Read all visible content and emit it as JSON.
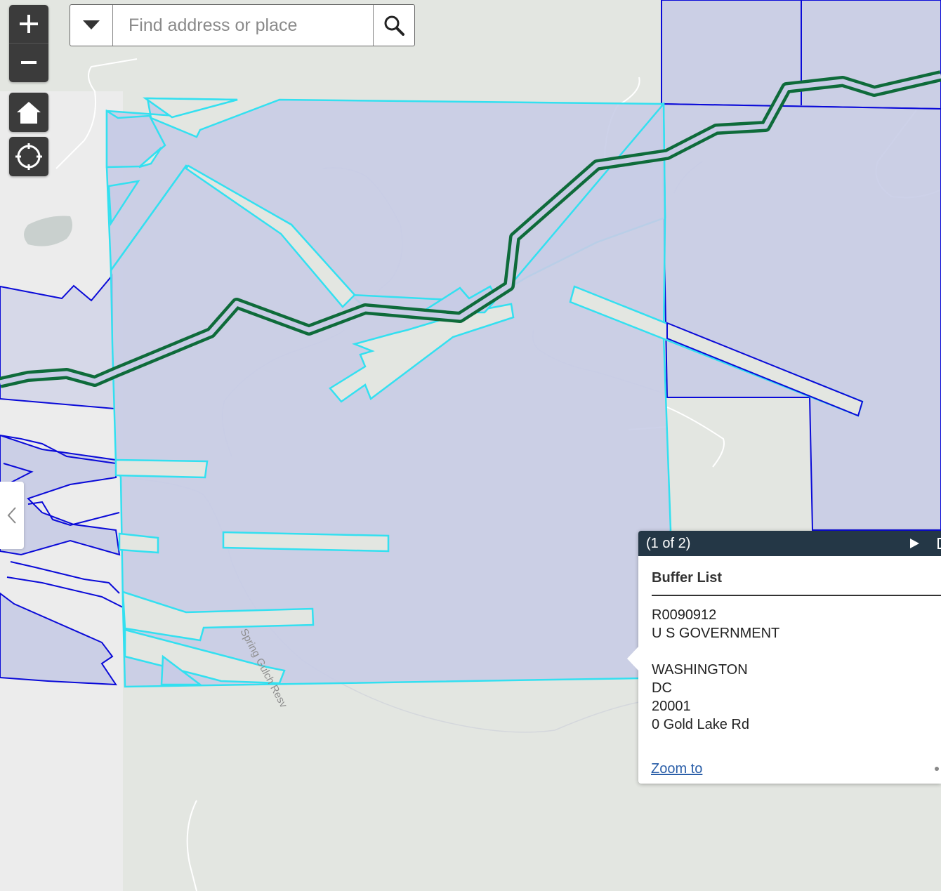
{
  "search": {
    "placeholder": "Find address or place"
  },
  "map": {
    "road_label": "Spring Gulch Resv"
  },
  "popup": {
    "pager": "(1 of 2)",
    "title": "Buffer List",
    "lines": [
      "R0090912",
      "U S GOVERNMENT",
      "",
      "WASHINGTON",
      "DC",
      "20001",
      "0 Gold Lake Rd"
    ],
    "zoom_link": "Zoom to"
  },
  "colors": {
    "parcel_fill": "#c8cce6",
    "parcel_outline": "#0a0ad8",
    "buffer_outline": "#33e0f0",
    "trail_line": "#0e6b3a",
    "control_bg": "#3b3b3b",
    "popup_header": "#243746"
  },
  "icons": [
    "plus-icon",
    "minus-icon",
    "home-icon",
    "locate-icon",
    "chevron-down-icon",
    "search-icon",
    "chevron-left-icon",
    "play-icon"
  ]
}
